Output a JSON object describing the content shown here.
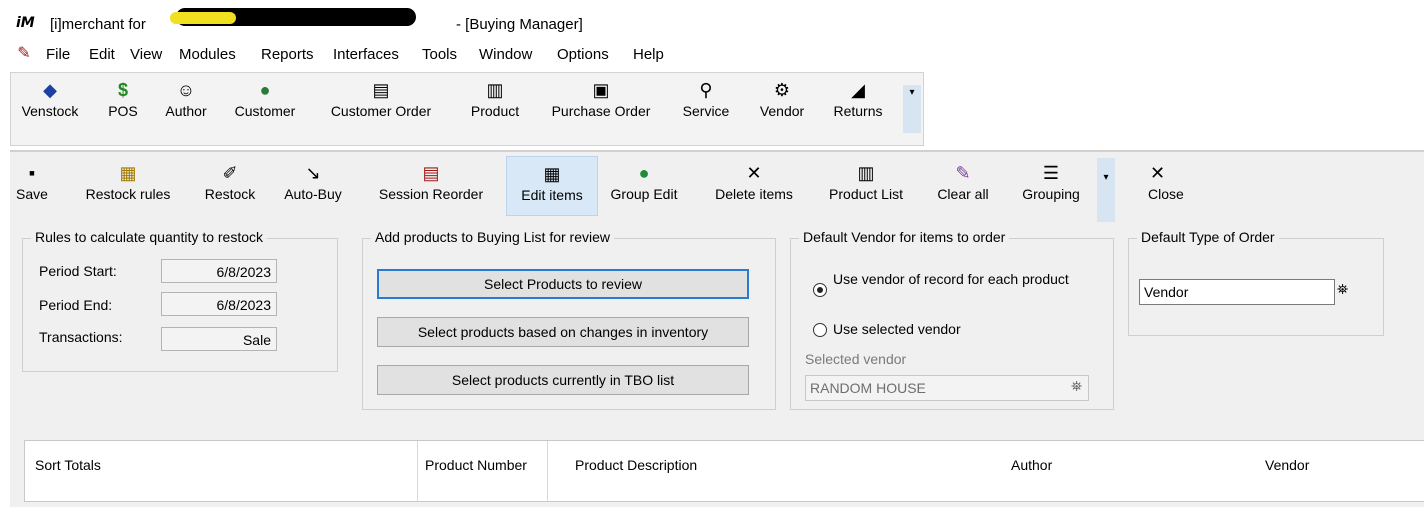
{
  "window": {
    "logo": "iM",
    "title_prefix": "[i]merchant for",
    "title_suffix": "- [Buying Manager]"
  },
  "menu": [
    "File",
    "Edit",
    "View",
    "Modules",
    "Reports",
    "Interfaces",
    "Tools",
    "Window",
    "Options",
    "Help"
  ],
  "modules": [
    {
      "label": "Venstock",
      "icon": "venstock-icon"
    },
    {
      "label": "POS",
      "icon": "dollar-icon"
    },
    {
      "label": "Author",
      "icon": "author-icon"
    },
    {
      "label": "Customer",
      "icon": "customer-globe-icon"
    },
    {
      "label": "Customer Order",
      "icon": "customer-order-icon"
    },
    {
      "label": "Product",
      "icon": "product-icon"
    },
    {
      "label": "Purchase Order",
      "icon": "purchase-order-icon"
    },
    {
      "label": "Service",
      "icon": "wrench-icon"
    },
    {
      "label": "Vendor",
      "icon": "vendor-icon"
    },
    {
      "label": "Returns",
      "icon": "returns-icon"
    }
  ],
  "actions": [
    {
      "label": "Save",
      "icon": "save-icon"
    },
    {
      "label": "Restock rules",
      "icon": "restock-rules-icon"
    },
    {
      "label": "Restock",
      "icon": "restock-icon"
    },
    {
      "label": "Auto-Buy",
      "icon": "auto-buy-icon"
    },
    {
      "label": "Session Reorder",
      "icon": "session-reorder-icon"
    },
    {
      "label": "Edit items",
      "icon": "edit-items-icon"
    },
    {
      "label": "Group Edit",
      "icon": "group-edit-icon"
    },
    {
      "label": "Delete items",
      "icon": "delete-icon"
    },
    {
      "label": "Product List",
      "icon": "product-list-icon"
    },
    {
      "label": "Clear all",
      "icon": "clear-all-icon"
    },
    {
      "label": "Grouping",
      "icon": "grouping-icon"
    },
    {
      "label": "Close",
      "icon": "close-icon"
    }
  ],
  "rules": {
    "legend": "Rules to calculate quantity to restock",
    "period_start_label": "Period Start:",
    "period_start_value": "6/8/2023",
    "period_end_label": "Period End:",
    "period_end_value": "6/8/2023",
    "transactions_label": "Transactions:",
    "transactions_value": "Sale"
  },
  "add_products": {
    "legend": "Add products to Buying List for review",
    "btn_review": "Select Products to review",
    "btn_inventory": "Select products based on changes in inventory",
    "btn_tbo": "Select products currently in TBO list"
  },
  "vendor_default": {
    "legend": "Default Vendor for items to order",
    "radio_record": "Use vendor of record for each product",
    "radio_selected": "Use selected vendor",
    "selected_label": "Selected vendor",
    "selected_value": "RANDOM HOUSE"
  },
  "order_type": {
    "legend": "Default Type of Order",
    "value": "Vendor"
  },
  "grid": {
    "columns": [
      "Sort Totals",
      "Product Number",
      "Product Description",
      "Author",
      "Vendor"
    ]
  },
  "colors": {
    "highlight": "#d9e8f6",
    "focus_border": "#2a7bd0",
    "redaction_yellow": "#f0e020"
  }
}
